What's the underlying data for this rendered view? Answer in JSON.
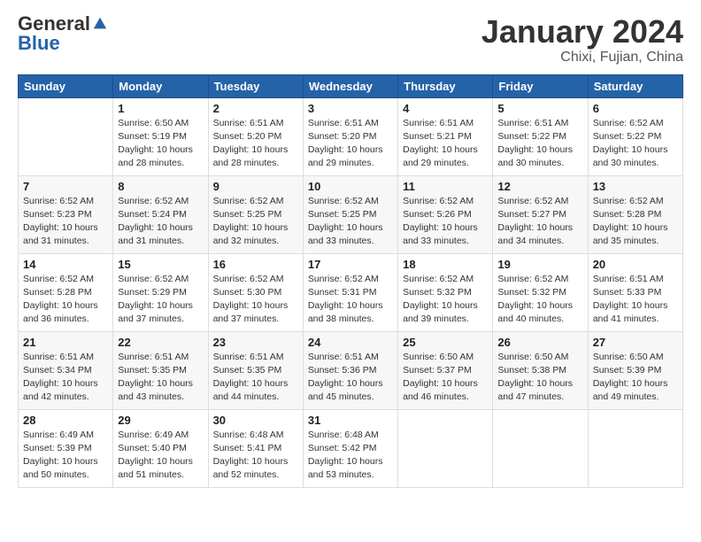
{
  "logo": {
    "general": "General",
    "blue": "Blue"
  },
  "header": {
    "month": "January 2024",
    "location": "Chixi, Fujian, China"
  },
  "weekdays": [
    "Sunday",
    "Monday",
    "Tuesday",
    "Wednesday",
    "Thursday",
    "Friday",
    "Saturday"
  ],
  "weeks": [
    [
      {
        "day": "",
        "info": ""
      },
      {
        "day": "1",
        "info": "Sunrise: 6:50 AM\nSunset: 5:19 PM\nDaylight: 10 hours\nand 28 minutes."
      },
      {
        "day": "2",
        "info": "Sunrise: 6:51 AM\nSunset: 5:20 PM\nDaylight: 10 hours\nand 28 minutes."
      },
      {
        "day": "3",
        "info": "Sunrise: 6:51 AM\nSunset: 5:20 PM\nDaylight: 10 hours\nand 29 minutes."
      },
      {
        "day": "4",
        "info": "Sunrise: 6:51 AM\nSunset: 5:21 PM\nDaylight: 10 hours\nand 29 minutes."
      },
      {
        "day": "5",
        "info": "Sunrise: 6:51 AM\nSunset: 5:22 PM\nDaylight: 10 hours\nand 30 minutes."
      },
      {
        "day": "6",
        "info": "Sunrise: 6:52 AM\nSunset: 5:22 PM\nDaylight: 10 hours\nand 30 minutes."
      }
    ],
    [
      {
        "day": "7",
        "info": "Sunrise: 6:52 AM\nSunset: 5:23 PM\nDaylight: 10 hours\nand 31 minutes."
      },
      {
        "day": "8",
        "info": "Sunrise: 6:52 AM\nSunset: 5:24 PM\nDaylight: 10 hours\nand 31 minutes."
      },
      {
        "day": "9",
        "info": "Sunrise: 6:52 AM\nSunset: 5:25 PM\nDaylight: 10 hours\nand 32 minutes."
      },
      {
        "day": "10",
        "info": "Sunrise: 6:52 AM\nSunset: 5:25 PM\nDaylight: 10 hours\nand 33 minutes."
      },
      {
        "day": "11",
        "info": "Sunrise: 6:52 AM\nSunset: 5:26 PM\nDaylight: 10 hours\nand 33 minutes."
      },
      {
        "day": "12",
        "info": "Sunrise: 6:52 AM\nSunset: 5:27 PM\nDaylight: 10 hours\nand 34 minutes."
      },
      {
        "day": "13",
        "info": "Sunrise: 6:52 AM\nSunset: 5:28 PM\nDaylight: 10 hours\nand 35 minutes."
      }
    ],
    [
      {
        "day": "14",
        "info": "Sunrise: 6:52 AM\nSunset: 5:28 PM\nDaylight: 10 hours\nand 36 minutes."
      },
      {
        "day": "15",
        "info": "Sunrise: 6:52 AM\nSunset: 5:29 PM\nDaylight: 10 hours\nand 37 minutes."
      },
      {
        "day": "16",
        "info": "Sunrise: 6:52 AM\nSunset: 5:30 PM\nDaylight: 10 hours\nand 37 minutes."
      },
      {
        "day": "17",
        "info": "Sunrise: 6:52 AM\nSunset: 5:31 PM\nDaylight: 10 hours\nand 38 minutes."
      },
      {
        "day": "18",
        "info": "Sunrise: 6:52 AM\nSunset: 5:32 PM\nDaylight: 10 hours\nand 39 minutes."
      },
      {
        "day": "19",
        "info": "Sunrise: 6:52 AM\nSunset: 5:32 PM\nDaylight: 10 hours\nand 40 minutes."
      },
      {
        "day": "20",
        "info": "Sunrise: 6:51 AM\nSunset: 5:33 PM\nDaylight: 10 hours\nand 41 minutes."
      }
    ],
    [
      {
        "day": "21",
        "info": "Sunrise: 6:51 AM\nSunset: 5:34 PM\nDaylight: 10 hours\nand 42 minutes."
      },
      {
        "day": "22",
        "info": "Sunrise: 6:51 AM\nSunset: 5:35 PM\nDaylight: 10 hours\nand 43 minutes."
      },
      {
        "day": "23",
        "info": "Sunrise: 6:51 AM\nSunset: 5:35 PM\nDaylight: 10 hours\nand 44 minutes."
      },
      {
        "day": "24",
        "info": "Sunrise: 6:51 AM\nSunset: 5:36 PM\nDaylight: 10 hours\nand 45 minutes."
      },
      {
        "day": "25",
        "info": "Sunrise: 6:50 AM\nSunset: 5:37 PM\nDaylight: 10 hours\nand 46 minutes."
      },
      {
        "day": "26",
        "info": "Sunrise: 6:50 AM\nSunset: 5:38 PM\nDaylight: 10 hours\nand 47 minutes."
      },
      {
        "day": "27",
        "info": "Sunrise: 6:50 AM\nSunset: 5:39 PM\nDaylight: 10 hours\nand 49 minutes."
      }
    ],
    [
      {
        "day": "28",
        "info": "Sunrise: 6:49 AM\nSunset: 5:39 PM\nDaylight: 10 hours\nand 50 minutes."
      },
      {
        "day": "29",
        "info": "Sunrise: 6:49 AM\nSunset: 5:40 PM\nDaylight: 10 hours\nand 51 minutes."
      },
      {
        "day": "30",
        "info": "Sunrise: 6:48 AM\nSunset: 5:41 PM\nDaylight: 10 hours\nand 52 minutes."
      },
      {
        "day": "31",
        "info": "Sunrise: 6:48 AM\nSunset: 5:42 PM\nDaylight: 10 hours\nand 53 minutes."
      },
      {
        "day": "",
        "info": ""
      },
      {
        "day": "",
        "info": ""
      },
      {
        "day": "",
        "info": ""
      }
    ]
  ]
}
